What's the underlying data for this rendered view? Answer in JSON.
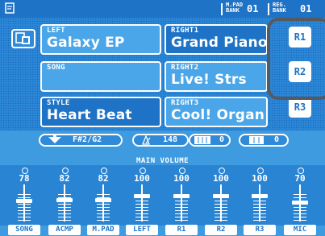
{
  "header": {
    "mpad_tag_top": "M.PAD",
    "mpad_tag_bottom": "BANK",
    "mpad_bank": "01",
    "reg_tag_top": "REG.",
    "reg_tag_bottom": "BANK",
    "reg_bank": "01"
  },
  "voices": {
    "left": {
      "label": "LEFT",
      "name": "Galaxy EP"
    },
    "right1": {
      "label": "RIGHT1",
      "name": "Grand Piano"
    },
    "song": {
      "label": "SONG",
      "name": ""
    },
    "right2": {
      "label": "RIGHT2",
      "name": "Live! Strs"
    },
    "style": {
      "label": "STYLE",
      "name": "Heart Beat"
    },
    "right3": {
      "label": "RIGHT3",
      "name": "Cool! Organ"
    }
  },
  "part_buttons": {
    "r1": "R1",
    "r2": "R2",
    "r3": "R3"
  },
  "status": {
    "transpose": "F#2/G2",
    "tempo": "148",
    "bar": "0",
    "beat": "0"
  },
  "main_volume": {
    "title": "MAIN VOLUME",
    "channels": [
      {
        "label": "SONG",
        "value": "78"
      },
      {
        "label": "ACMP",
        "value": "82"
      },
      {
        "label": "M.PAD",
        "value": "82"
      },
      {
        "label": "LEFT",
        "value": "100"
      },
      {
        "label": "R1",
        "value": "100"
      },
      {
        "label": "R2",
        "value": "100"
      },
      {
        "label": "R3",
        "value": "100"
      },
      {
        "label": "MIC",
        "value": "70"
      }
    ]
  },
  "colors": {
    "accent": "#1e73c6",
    "panel": "#3f9be0",
    "highlight_ring": "#555a5e"
  }
}
